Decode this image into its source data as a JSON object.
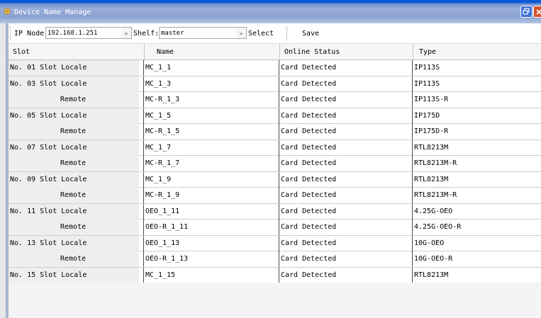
{
  "window": {
    "title": "Device Name Manage",
    "colors": {
      "titlebar": "#0a5ad6",
      "close": "#d9542b"
    }
  },
  "toolbar": {
    "ip_node_label": "IP Node",
    "ip_node_value": "192.168.1.251",
    "shelf_label": "Shelf:",
    "shelf_value": "master",
    "select_label": "Select",
    "save_label": "Save"
  },
  "table": {
    "headers": [
      "Slot",
      "Name",
      "Online Status",
      "Type"
    ],
    "rows": [
      {
        "slot": "No. 01 Slot Locale",
        "name": "MC_1_1",
        "status": "Card Detected",
        "type": "IP113S"
      },
      {
        "slot": "No. 03 Slot Locale",
        "name": "MC_1_3",
        "status": "Card Detected",
        "type": "IP113S"
      },
      {
        "slot": "Remote",
        "name": "MC-R_1_3",
        "status": "Card Detected",
        "type": "IP113S-R"
      },
      {
        "slot": "No. 05 Slot Locale",
        "name": "MC_1_5",
        "status": "Card Detected",
        "type": "IP175D"
      },
      {
        "slot": "Remote",
        "name": "MC-R_1_5",
        "status": "Card Detected",
        "type": "IP175D-R"
      },
      {
        "slot": "No. 07 Slot Locale",
        "name": "MC_1_7",
        "status": "Card Detected",
        "type": "RTL8213M"
      },
      {
        "slot": "Remote",
        "name": "MC-R_1_7",
        "status": "Card Detected",
        "type": "RTL8213M-R"
      },
      {
        "slot": "No. 09 Slot Locale",
        "name": "MC_1_9",
        "status": "Card Detected",
        "type": "RTL8213M"
      },
      {
        "slot": "Remote",
        "name": "MC-R_1_9",
        "status": "Card Detected",
        "type": "RTL8213M-R"
      },
      {
        "slot": "No. 11 Slot Locale",
        "name": "OEO_1_11",
        "status": "Card Detected",
        "type": "4.25G-OEO"
      },
      {
        "slot": "Remote",
        "name": "OEO-R_1_11",
        "status": "Card Detected",
        "type": "4.25G-OEO-R"
      },
      {
        "slot": "No. 13 Slot Locale",
        "name": "OEO_1_13",
        "status": "Card Detected",
        "type": "10G-OEO"
      },
      {
        "slot": "Remote",
        "name": "OEO-R_1_13",
        "status": "Card Detected",
        "type": "10G-OEO-R"
      },
      {
        "slot": "No. 15 Slot Locale",
        "name": "MC_1_15",
        "status": "Card Detected",
        "type": "RTL8213M"
      }
    ]
  }
}
